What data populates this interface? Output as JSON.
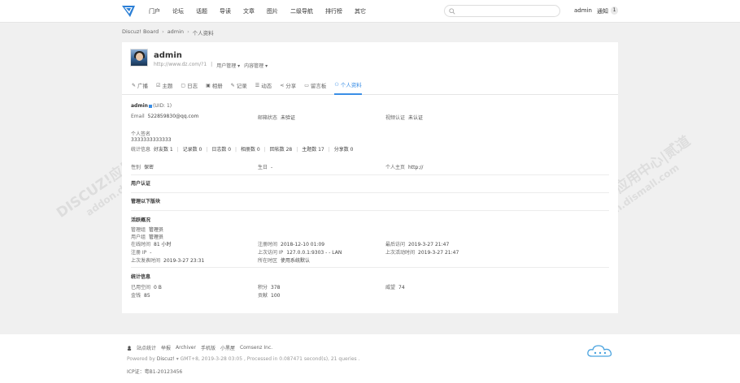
{
  "nav": {
    "items": [
      "门户",
      "论坛",
      "话题",
      "导读",
      "文章",
      "图片",
      "二级导航",
      "排行榜",
      "其它"
    ],
    "search_placeholder": "",
    "user": "admin",
    "notice_label": "通知",
    "notice_count": "1"
  },
  "breadcrumb": [
    "Discuz! Board",
    "admin",
    "个人资料"
  ],
  "profile": {
    "name": "admin",
    "url": "http://www.dz.com/?1",
    "menu1": "用户管理",
    "menu2": "内容管理"
  },
  "tabs": [
    {
      "icon": "megaphone-icon",
      "glyph": "✎",
      "label": "广播"
    },
    {
      "icon": "topic-icon",
      "glyph": "☑",
      "label": "主题"
    },
    {
      "icon": "diary-icon",
      "glyph": "▢",
      "label": "日志"
    },
    {
      "icon": "album-icon",
      "glyph": "▣",
      "label": "相册"
    },
    {
      "icon": "pencil-icon",
      "glyph": "✎",
      "label": "记录"
    },
    {
      "icon": "feed-icon",
      "glyph": "☰",
      "label": "动态"
    },
    {
      "icon": "share-icon",
      "glyph": "⋖",
      "label": "分享"
    },
    {
      "icon": "board-icon",
      "glyph": "▭",
      "label": "留言板"
    },
    {
      "icon": "user-icon",
      "glyph": "⚇",
      "label": "个人资料"
    }
  ],
  "info": {
    "username": "admin",
    "uid": "(UID: 1)",
    "email_k": "Email",
    "email_v": "522859830@qq.com",
    "mail_status_k": "邮箱状态",
    "mail_status_v": "未验证",
    "video_k": "视频认证",
    "video_v": "未认证",
    "sig_k": "个人签名",
    "sig_v": "3333333333333",
    "stat_k": "统计信息",
    "stats": [
      "好友数 1",
      "记录数 0",
      "日志数 0",
      "相册数 0",
      "回帖数 28",
      "主题数 17",
      "分享数 0"
    ],
    "gender_k": "性别",
    "gender_v": "保密",
    "birthday_k": "生日",
    "birthday_v": "-",
    "home_k": "个人主页",
    "home_v": "http://"
  },
  "sections": {
    "user_cert": "用户认证",
    "manage": "管理以下版块",
    "activity": "活跃概况",
    "statistics": "统计信息"
  },
  "activity": {
    "admin_group_k": "管理组",
    "admin_group_v": "管理员",
    "user_group_k": "用户组",
    "user_group_v": "管理员",
    "online_k": "在线时间",
    "online_v": "81 小时",
    "reg_time_k": "注册时间",
    "reg_time_v": "2018-12-10 01:09",
    "last_visit_k": "最后访问",
    "last_visit_v": "2019-3-27 21:47",
    "reg_ip_k": "注册 IP",
    "reg_ip_v": "-",
    "last_ip_k": "上次访问 IP",
    "last_ip_v": "127.0.0.1:9303 - - LAN",
    "last_active_k": "上次活动时间",
    "last_active_v": "2019-3-27 21:47",
    "last_post_k": "上次发表时间",
    "last_post_v": "2019-3-27 23:31",
    "timezone_k": "所在时区",
    "timezone_v": "使用系统默认"
  },
  "statistics": {
    "space_k": "已用空间",
    "space_v": "0 B",
    "points_k": "积分",
    "points_v": "378",
    "prestige_k": "威望",
    "prestige_v": "74",
    "money_k": "金钱",
    "money_v": "85",
    "contrib_k": "贡献",
    "contrib_v": "100"
  },
  "watermark": {
    "line1": "DISCUZ!应用中心|贰道",
    "line2": "addon.dismall.com"
  },
  "footer": {
    "links": [
      "站点统计",
      "举报",
      "Archiver",
      "手机版",
      "小黑屋",
      "Comsenz Inc."
    ],
    "powered_prefix": "Powered by",
    "powered_name": "Discuz!",
    "powered_rest": "GMT+8, 2019-3-28 03:05 , Processed in 0.087471 second(s), 21 queries .",
    "icp": "ICP证：粤B1-20123456"
  }
}
